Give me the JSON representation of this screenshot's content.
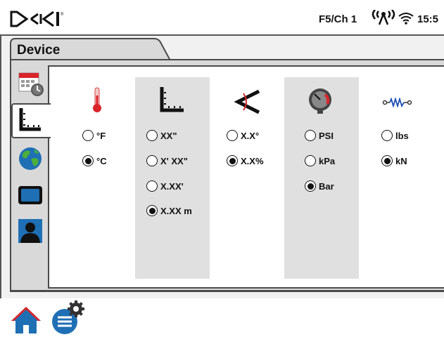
{
  "status_bar": {
    "logo_text": "DCI",
    "channel": "F5/Ch 1",
    "time": "15:5",
    "icons": [
      "signal-antenna-icon",
      "wifi-icon"
    ]
  },
  "tab": {
    "label": "Device"
  },
  "side_tabs": [
    {
      "name": "calendar-clock-icon",
      "active": false
    },
    {
      "name": "length-unit-icon",
      "active": true
    },
    {
      "name": "globe-icon",
      "active": false
    },
    {
      "name": "display-icon",
      "active": false
    },
    {
      "name": "user-profile-icon",
      "active": false
    }
  ],
  "columns": [
    {
      "name": "temperature",
      "icon": "thermometer-icon",
      "options": [
        {
          "label": "°F",
          "selected": false
        },
        {
          "label": "°C",
          "selected": true
        }
      ]
    },
    {
      "name": "length",
      "icon": "length-unit-icon",
      "options": [
        {
          "label": "XX\"",
          "selected": false
        },
        {
          "label": "X' XX\"",
          "selected": false
        },
        {
          "label": "X.XX'",
          "selected": false
        },
        {
          "label": "X.XX m",
          "selected": true
        }
      ]
    },
    {
      "name": "pitch",
      "icon": "pitch-angle-icon",
      "options": [
        {
          "label": "X.X°",
          "selected": false
        },
        {
          "label": "X.X%",
          "selected": true
        }
      ]
    },
    {
      "name": "pressure",
      "icon": "pressure-gauge-icon",
      "options": [
        {
          "label": "PSI",
          "selected": false
        },
        {
          "label": "kPa",
          "selected": false
        },
        {
          "label": "Bar",
          "selected": true
        }
      ]
    },
    {
      "name": "tension",
      "icon": "tension-spring-icon",
      "options": [
        {
          "label": "lbs",
          "selected": false
        },
        {
          "label": "kN",
          "selected": true
        }
      ]
    }
  ],
  "bottom_bar": {
    "icons": [
      "home-icon",
      "settings-menu-icon"
    ]
  },
  "colors": {
    "frame": "#4a4a4a",
    "column_shade": "#e0e0e0",
    "home_blue": "#1f6fb5",
    "accent_red": "#d9252a"
  }
}
